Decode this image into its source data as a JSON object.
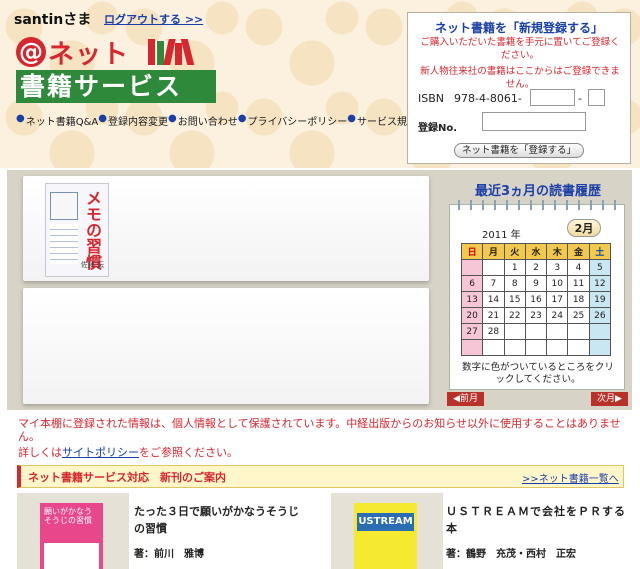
{
  "header": {
    "username": "santinさま",
    "logout_link": "ログアウトする >>",
    "logo": {
      "line1_at": "@",
      "line1": "ネット",
      "line2": "書籍サービス"
    },
    "nav": [
      "ネット書籍Q&A",
      "登録内容変更",
      "お問い合わせ",
      "プライバシーポリシー",
      "サービス規約"
    ]
  },
  "registration": {
    "title": "ネット書籍を「新規登録する」",
    "note1": "ご購入いただいた書籍を手元に置いてご登録ください。",
    "note2": "新人物往来社の書籍はここからはご登録できません。",
    "isbn_label": "ISBN",
    "isbn_prefix": "978-4-8061-",
    "isbn_dash": "-",
    "isbn_value1": "",
    "isbn_value2": "",
    "regno_label": "登録No.",
    "regno_value": "",
    "submit_button": "ネット書籍を「登録する」"
  },
  "shelf": {
    "books": [
      {
        "title": "メモの習慣",
        "author": "佐藤 伝"
      }
    ]
  },
  "calendar": {
    "title": "最近3ヵ月の読書履歴",
    "year": "2011 年",
    "month": "2月",
    "weekdays": [
      "日",
      "月",
      "火",
      "水",
      "木",
      "金",
      "土"
    ],
    "weeks": [
      [
        "",
        "",
        "1",
        "2",
        "3",
        "4",
        "5"
      ],
      [
        "6",
        "7",
        "8",
        "9",
        "10",
        "11",
        "12"
      ],
      [
        "13",
        "14",
        "15",
        "16",
        "17",
        "18",
        "19"
      ],
      [
        "20",
        "21",
        "22",
        "23",
        "24",
        "25",
        "26"
      ],
      [
        "27",
        "28",
        "",
        "",
        "",
        "",
        ""
      ],
      [
        "",
        "",
        "",
        "",
        "",
        "",
        ""
      ]
    ],
    "note": "数字に色がついているところをクリックしてください。",
    "prev_button": "◀前月",
    "next_button": "次月▶",
    "colors": {
      "sunday": "#f6c6d6",
      "saturday": "#c9e6f3",
      "header": "#f2c94c"
    }
  },
  "notice": {
    "line1": "マイ本棚に登録された情報は、個人情報として保護されています。中経出版からのお知らせ以外に使用することはありません。",
    "line2_prefix": "詳しくは",
    "line2_link": "サイトポリシー",
    "line2_suffix": "をご参照ください。"
  },
  "new_books": {
    "header": "ネット書籍サービス対応　新刊のご案内",
    "list_link": ">>ネット書籍一覧へ",
    "items": [
      {
        "title": "たった３日で願いがかなうそうじの習慣",
        "author": "著：前川　雅博",
        "cover_text": "願いがかなう そうじの習慣"
      },
      {
        "title": "ＵＳＴＲＥＡＭで会社をＰＲする本",
        "author": "著：鶴野　充茂・西村　正宏",
        "cover_text": "USTREAM"
      }
    ]
  },
  "colors": {
    "accent_red": "#d8262f",
    "brand_green": "#2e8a3a",
    "link_blue": "#1a3fa8"
  }
}
